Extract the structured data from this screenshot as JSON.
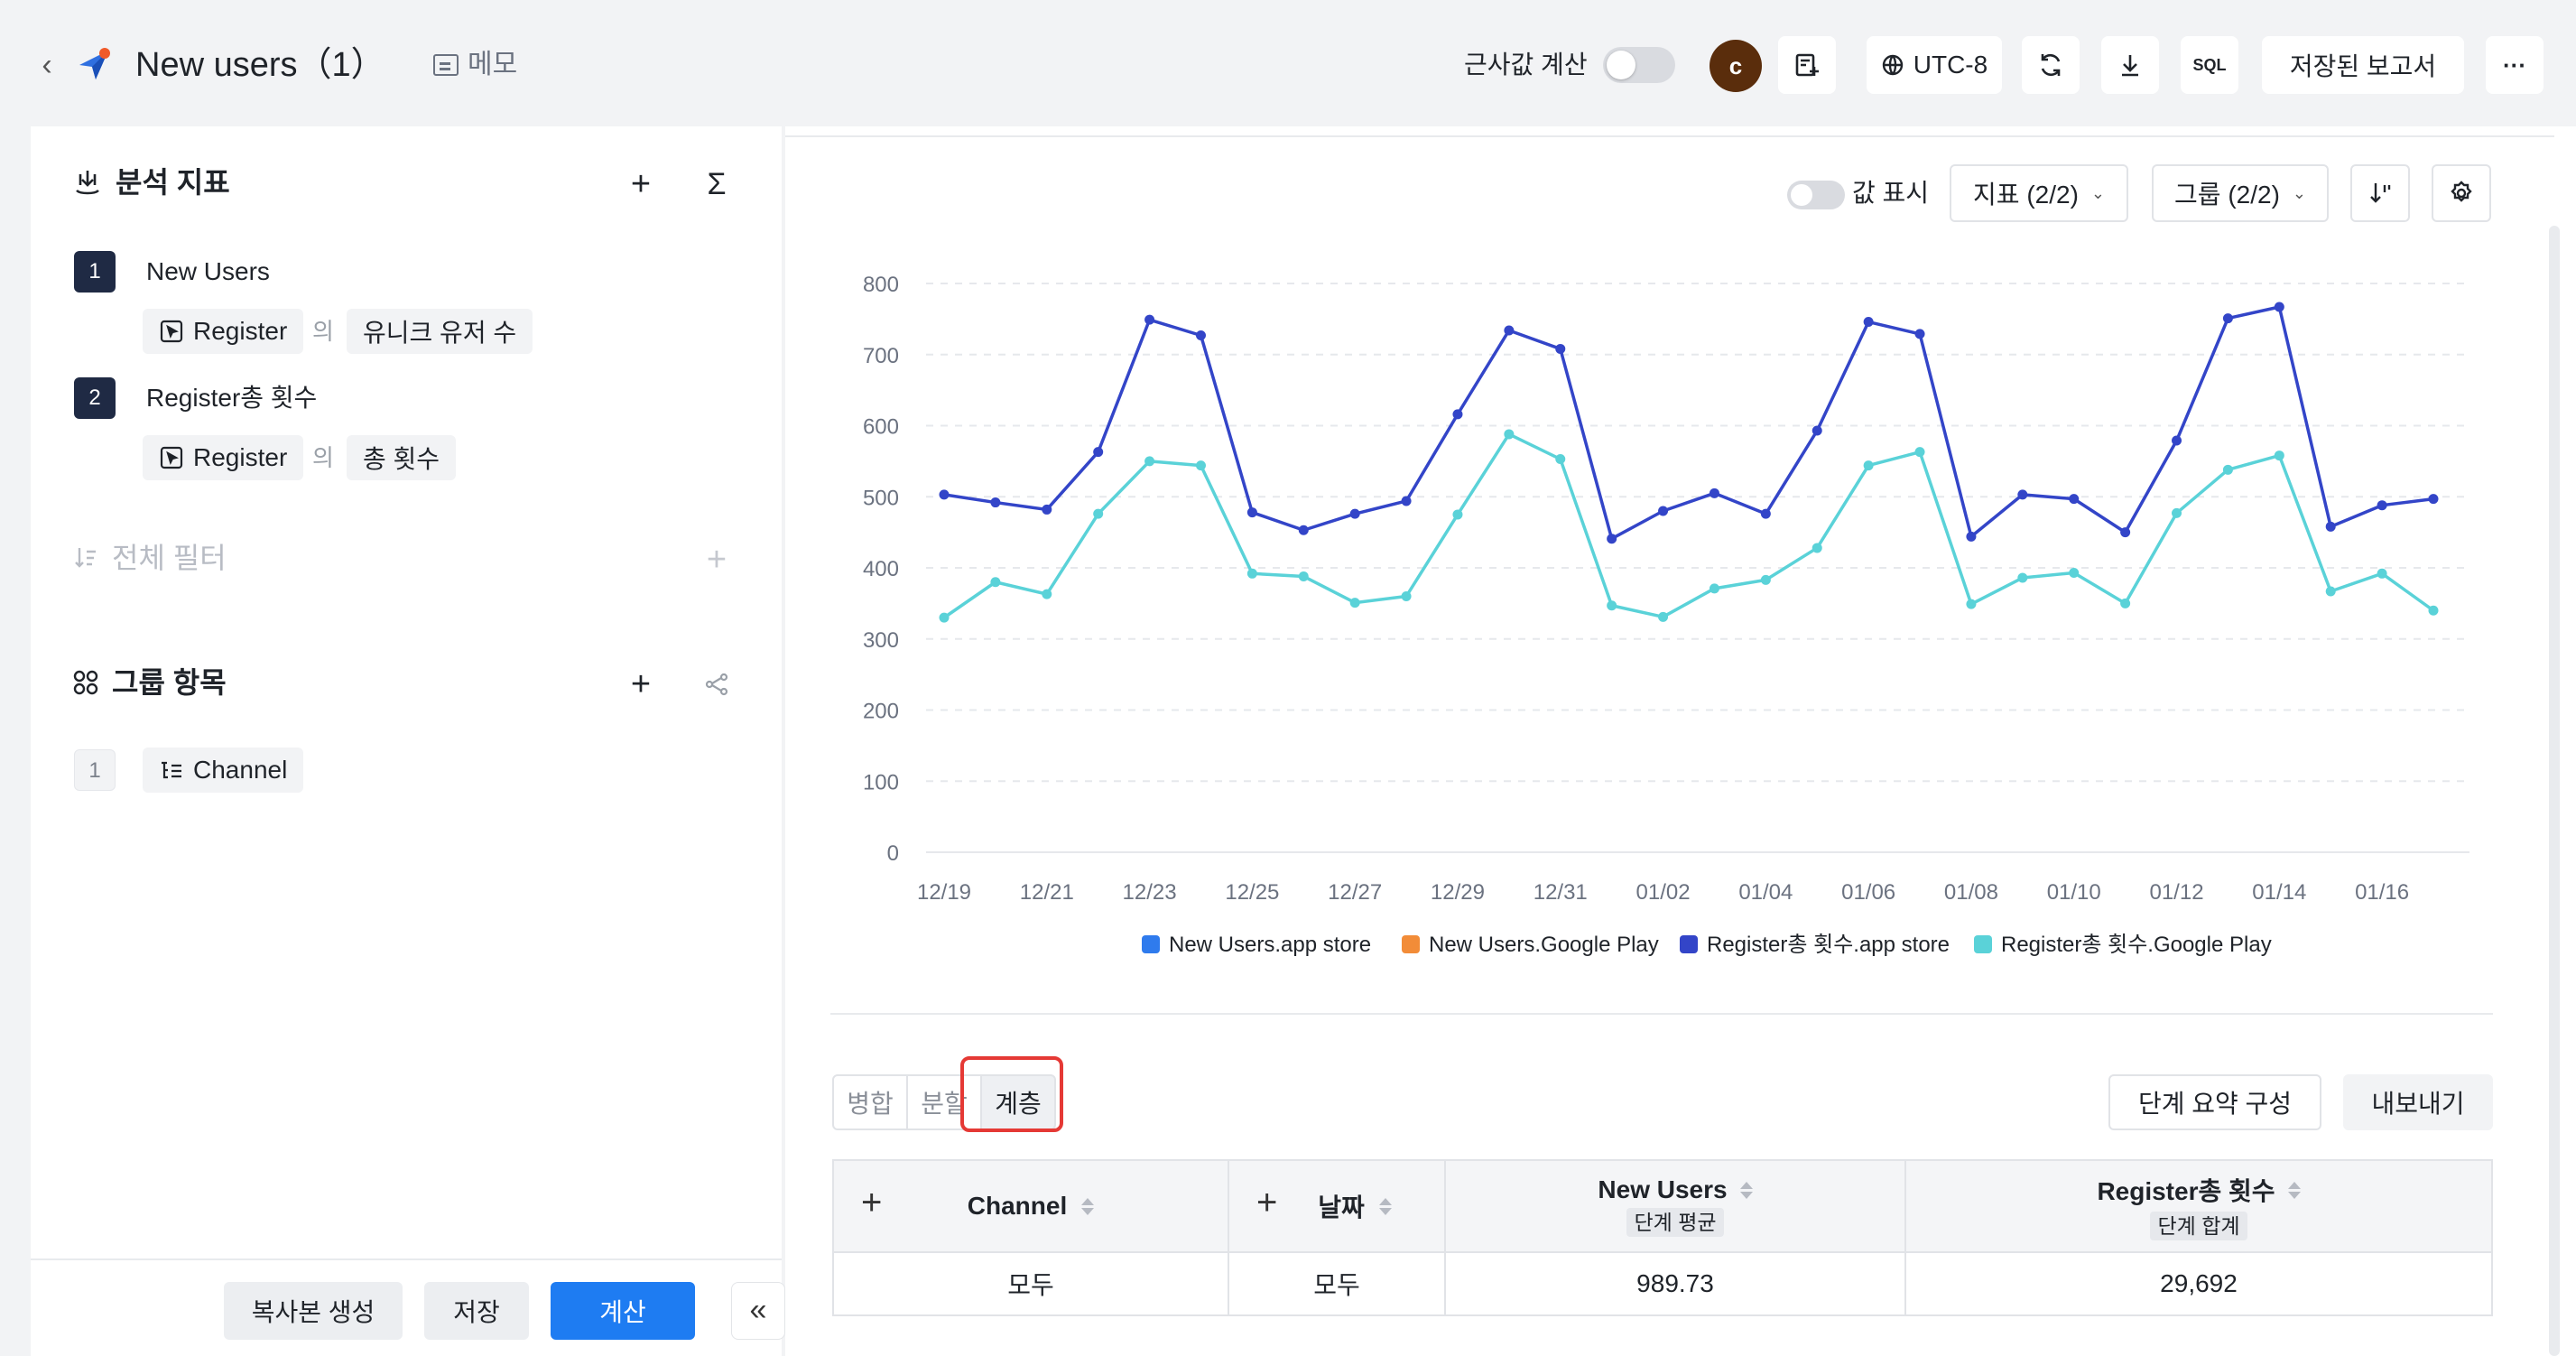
{
  "header": {
    "title": "New users（1）",
    "memo": "메모",
    "approx_label": "근사값 계산",
    "avatar_letter": "c",
    "timezone": "UTC-8",
    "sql": "SQL",
    "saved_reports": "저장된 보고서",
    "more": "···"
  },
  "left": {
    "metrics_title": "분석 지표",
    "metrics": [
      {
        "index": "1",
        "name": "New Users",
        "event": "Register",
        "of": "의",
        "measure": "유니크 유저 수"
      },
      {
        "index": "2",
        "name": "Register총 횟수",
        "event": "Register",
        "of": "의",
        "measure": "총 횟수"
      }
    ],
    "filter_title": "전체 필터",
    "group_title": "그룹 항목",
    "groups": [
      {
        "index": "1",
        "name": "Channel"
      }
    ],
    "footer": {
      "copy": "복사본 생성",
      "save": "저장",
      "calc": "계산",
      "collapse": "«"
    }
  },
  "toolbar": {
    "show_values": "값 표시",
    "metric_select": "지표 (2/2)",
    "group_select": "그룹 (2/2)"
  },
  "chart_data": {
    "type": "line",
    "x": [
      "12/19",
      "12/20",
      "12/21",
      "12/22",
      "12/23",
      "12/24",
      "12/25",
      "12/26",
      "12/27",
      "12/28",
      "12/29",
      "12/30",
      "12/31",
      "01/01",
      "01/02",
      "01/03",
      "01/04",
      "01/05",
      "01/06",
      "01/07",
      "01/08",
      "01/09",
      "01/10",
      "01/11",
      "01/12",
      "01/13",
      "01/14",
      "01/15",
      "01/16",
      "01/17"
    ],
    "x_tick_labels": [
      "12/19",
      "12/21",
      "12/23",
      "12/25",
      "12/27",
      "12/29",
      "12/31",
      "01/02",
      "01/04",
      "01/06",
      "01/08",
      "01/10",
      "01/12",
      "01/14",
      "01/16"
    ],
    "y_ticks": [
      0,
      100,
      200,
      300,
      400,
      500,
      600,
      700,
      800
    ],
    "ylim": [
      0,
      800
    ],
    "grid": true,
    "legend_position": "bottom",
    "series": [
      {
        "name": "New Users.app store",
        "color": "#2f7bed",
        "values": null
      },
      {
        "name": "New Users.Google Play",
        "color": "#f28c38",
        "values": null
      },
      {
        "name": "Register총 횟수.app store",
        "color": "#3345c8",
        "values": [
          503,
          492,
          482,
          563,
          749,
          727,
          478,
          453,
          476,
          494,
          616,
          734,
          708,
          441,
          480,
          505,
          476,
          593,
          746,
          729,
          444,
          503,
          497,
          450,
          579,
          751,
          767,
          458,
          488,
          497
        ]
      },
      {
        "name": "Register총 횟수.Google Play",
        "color": "#5ad2d8",
        "values": [
          330,
          380,
          363,
          476,
          550,
          544,
          392,
          388,
          351,
          360,
          475,
          588,
          553,
          347,
          331,
          371,
          383,
          428,
          544,
          563,
          349,
          386,
          393,
          350,
          477,
          538,
          558,
          367,
          392,
          340
        ]
      }
    ]
  },
  "table_view": {
    "modes": [
      "병합",
      "분할",
      "계층"
    ],
    "active_mode": "계층",
    "summary_btn": "단계 요약 구성",
    "export_btn": "내보내기"
  },
  "table": {
    "columns": [
      {
        "label": "Channel"
      },
      {
        "label": "날짜"
      },
      {
        "label": "New Users",
        "sub": "단계 평균"
      },
      {
        "label": "Register총 횟수",
        "sub": "단계 합계"
      }
    ],
    "rows": [
      [
        "모두",
        "모두",
        "989.73",
        "29,692"
      ]
    ]
  }
}
